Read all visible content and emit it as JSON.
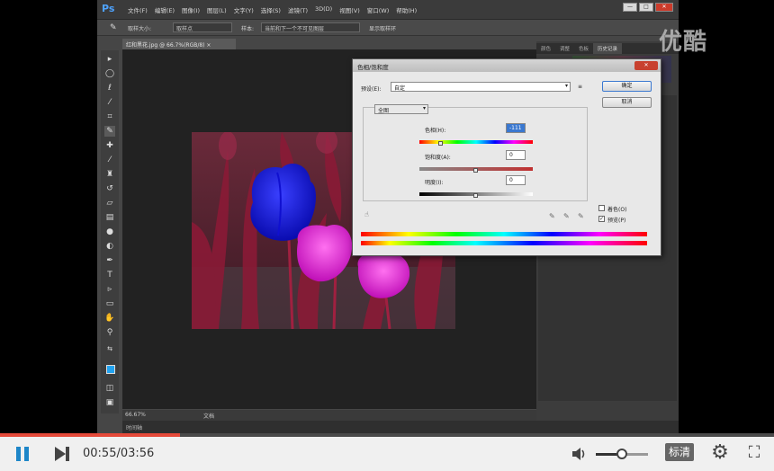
{
  "watermark": "优酷",
  "photoshop": {
    "logo": "Ps",
    "menus": [
      "文件(F)",
      "编辑(E)",
      "图像(I)",
      "图层(L)",
      "文字(Y)",
      "选择(S)",
      "滤镜(T)",
      "3D(D)",
      "视图(V)",
      "窗口(W)",
      "帮助(H)"
    ],
    "window_buttons": [
      "—",
      "□",
      "✕"
    ],
    "options": {
      "size_label": "取样大小:",
      "size_value": "取样点",
      "sample_label": "样本:",
      "sample_value": "当前和下一个不可见图层",
      "ring_label": "显示取样环"
    },
    "doc_tab": "红和黑花.jpg @ 66.7%(RGB/8) ×",
    "status": {
      "zoom": "66.67%",
      "info": "文档"
    },
    "bottom_tab": "时间轴",
    "panel_tabs": [
      "颜色",
      "调整",
      "色板",
      "历史记录"
    ],
    "panel_active_tab": 3
  },
  "dialog": {
    "title": "色相/饱和度",
    "preset_label": "预设(E):",
    "preset_value": "自定",
    "channel_value": "全图",
    "hue_label": "色相(H):",
    "hue_value": "-111",
    "saturation_label": "饱和度(A):",
    "saturation_value": "0",
    "lightness_label": "明度(I):",
    "lightness_value": "0",
    "ok_label": "确定",
    "cancel_label": "取消",
    "colorize_label": "着色(O)",
    "preview_label": "预览(P)",
    "colorize_checked": false,
    "preview_checked": true,
    "hue_level": 0.19,
    "saturation_level": 0.5,
    "lightness_level": 0.5
  },
  "player": {
    "current_time": "00:55",
    "total_time": "03:56",
    "time_display": "00:55/03:56",
    "progress": 0.233,
    "volume": 0.5,
    "quality_label": "标清",
    "icons": {
      "pause": "pause-icon",
      "next": "next-icon",
      "volume": "volume-icon",
      "settings": "gear-icon",
      "fullscreen": "fullscreen-icon"
    }
  }
}
